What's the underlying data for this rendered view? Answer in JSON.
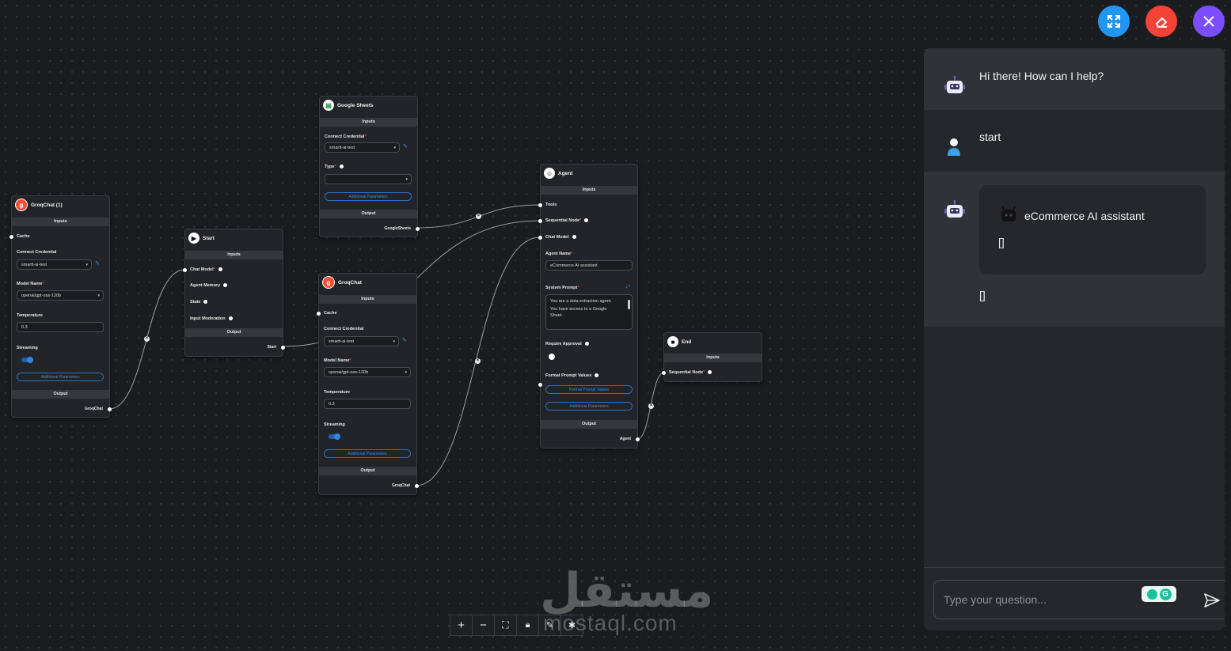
{
  "nodes": {
    "groqchat1": {
      "title": "GroqChat (1)",
      "inputs_label": "Inputs",
      "cache": "Cache",
      "credential_label": "Connect Credential",
      "credential_value": "smartt-ai-test",
      "model_label": "Model Name",
      "model_value": "openai/gpt-oss-120b",
      "temperature_label": "Temperature",
      "temperature_value": "0.3",
      "streaming_label": "Streaming",
      "additional": "Additional Parameters",
      "output_label": "Output",
      "output_value": "GroqChat"
    },
    "start": {
      "title": "Start",
      "inputs_label": "Inputs",
      "chat_model": "Chat Model",
      "agent_memory": "Agent Memory",
      "state": "State",
      "input_moderation": "Input Moderation",
      "output_label": "Output",
      "output_value": "Start"
    },
    "sheets": {
      "title": "Google Sheets",
      "inputs_label": "Inputs",
      "credential_label": "Connect Credential",
      "credential_value": "smartt-ai-test",
      "type_label": "Type",
      "additional": "Additional Parameters",
      "output_label": "Output",
      "output_value": "GoogleSheets"
    },
    "groqchat": {
      "title": "GroqChat",
      "inputs_label": "Inputs",
      "cache": "Cache",
      "credential_label": "Connect Credential",
      "credential_value": "smartt-ai-test",
      "model_label": "Model Name",
      "model_value": "openai/gpt-oss-120b",
      "temperature_label": "Temperature",
      "temperature_value": "0.3",
      "streaming_label": "Streaming",
      "additional": "Additional Parameters",
      "output_label": "Output",
      "output_value": "GroqChat"
    },
    "agent": {
      "title": "Agent",
      "inputs_label": "Inputs",
      "tools": "Tools",
      "sequential_node": "Sequential Node",
      "chat_model": "Chat Model",
      "agent_name_label": "Agent Name",
      "agent_name_value": "eCommerce AI assistant",
      "system_prompt_label": "System Prompt",
      "system_prompt_line1": "You are a data extraction agent.",
      "system_prompt_line2": "You have access to a Google",
      "system_prompt_line3": "Sheet.",
      "require_approval": "Require Approval",
      "format_prompt_label": "Format Prompt Values",
      "format_prompt_button": "Format Prompt Values",
      "additional": "Additional Parameters",
      "output_label": "Output",
      "output_value": "Agent"
    },
    "end": {
      "title": "End",
      "inputs_label": "Inputs",
      "sequential_node": "Sequential Node"
    }
  },
  "chat": {
    "greeting": "Hi there! How can I help?",
    "user_message": "start",
    "card_title": "eCommerce AI assistant",
    "card_body": "[]",
    "reply_body": "[]",
    "input_placeholder": "Type your question..."
  },
  "watermark": {
    "arabic": "مستقل",
    "latin": "mostaql.com"
  },
  "colors": {
    "expand_button": "#2196f3",
    "clear_button": "#f44336",
    "close_button": "#7c4dff",
    "accent_blue": "#3d8be0"
  },
  "icons": [
    "expand-icon",
    "eraser-icon",
    "close-icon",
    "zoom-in-icon",
    "zoom-out-icon",
    "fit-view-icon",
    "lock-icon",
    "send-icon",
    "robot-icon",
    "user-icon"
  ]
}
